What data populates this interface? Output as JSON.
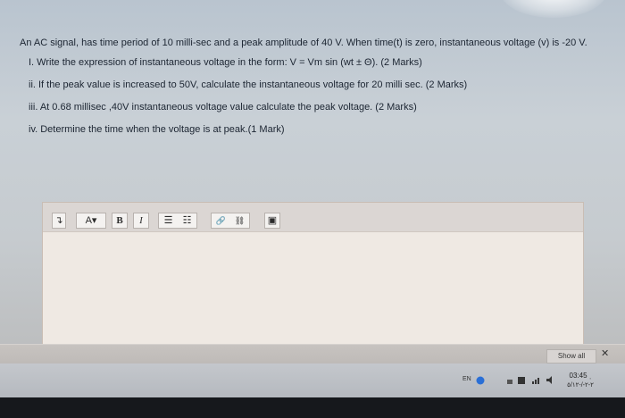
{
  "question": {
    "intro": "An AC signal, has time period of 10 milli-sec and a peak amplitude of 40 V. When time(t) is zero, instantaneous voltage (v) is -20 V.",
    "items": [
      "I. Write the expression of instantaneous voltage in the form:   V = Vm sin (wt ± Θ). (2 Marks)",
      "ii. If the peak value is increased to 50V, calculate the instantaneous voltage for 20 milli sec. (2 Marks)",
      "iii. At 0.68 millisec ,40V instantaneous voltage value calculate the peak voltage. (2 Marks)",
      "iv. Determine the time when the voltage is at peak.(1 Mark)"
    ]
  },
  "toolbar": {
    "paragraph": "↴",
    "font_color": "A▾",
    "bold": "B",
    "italic": "I",
    "bullet_list": "☰",
    "numbered_list": "☷",
    "link": "🔗",
    "unlink": "⛓",
    "image": "▣"
  },
  "download_bar": {
    "show_all": "Show all",
    "close": "✕"
  },
  "taskbar": {
    "language": "EN",
    "time": "03:45 ˌ",
    "date": "٢-٢-/-٥/١٢"
  }
}
